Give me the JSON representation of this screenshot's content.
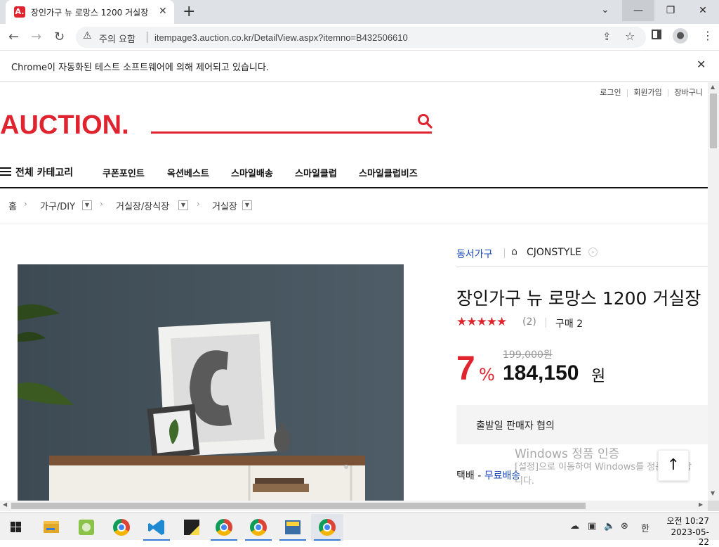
{
  "tab": {
    "favicon": "A.",
    "title": "장인가구 뉴 로망스 1200 거실장",
    "close_icon": "close-icon",
    "new_tab": "+"
  },
  "window": {
    "min": "—",
    "max": "❐",
    "close": "✕",
    "tab_search": "⌄"
  },
  "toolbar": {
    "back": "←",
    "forward": "→",
    "reload": "↻",
    "security_label": "주의 요함",
    "url": "itempage3.auction.co.kr/DetailView.aspx?itemno=B432506610"
  },
  "infobar": {
    "text": "Chrome이 자동화된 테스트 소프트웨어에 의해 제어되고 있습니다.",
    "close": "✕"
  },
  "header": {
    "util_links": [
      "로그인",
      "회원가입",
      "장바구니"
    ],
    "logo": "AUCTION.",
    "all_categories": "전체 카테고리",
    "nav": [
      "쿠폰포인트",
      "옥션베스트",
      "스마일배송",
      "스마일클럽",
      "스마일클럽비즈"
    ]
  },
  "breadcrumb": {
    "home": "홈",
    "levels": [
      "가구/DIY",
      "거실장/장식장",
      "거실장"
    ]
  },
  "product": {
    "seller": "동서가구",
    "shop": "CJONSTYLE",
    "title": "장인가구 뉴 로망스 1200 거실장",
    "rating": 5,
    "stars": "★★★★★",
    "review_count": "(2)",
    "purchase": "구매 2",
    "discount": "7",
    "discount_unit": "%",
    "original_price": "199,000원",
    "sale_price": "184,150",
    "sale_unit": "원",
    "shipping_note": "출발일 판매자 협의",
    "delivery_label": "택배 - ",
    "delivery_value": "무료배송"
  },
  "watermark": {
    "title": "Windows 정품 인증",
    "subtitle": "[설정]으로 이동하여 Windows를 정품 인증합니다."
  },
  "taskbar": {
    "time": "오전 10:27",
    "date": "2023-05-22",
    "ime": "한"
  },
  "colors": {
    "brand": "#e0242f",
    "link": "#1a4bb5"
  }
}
